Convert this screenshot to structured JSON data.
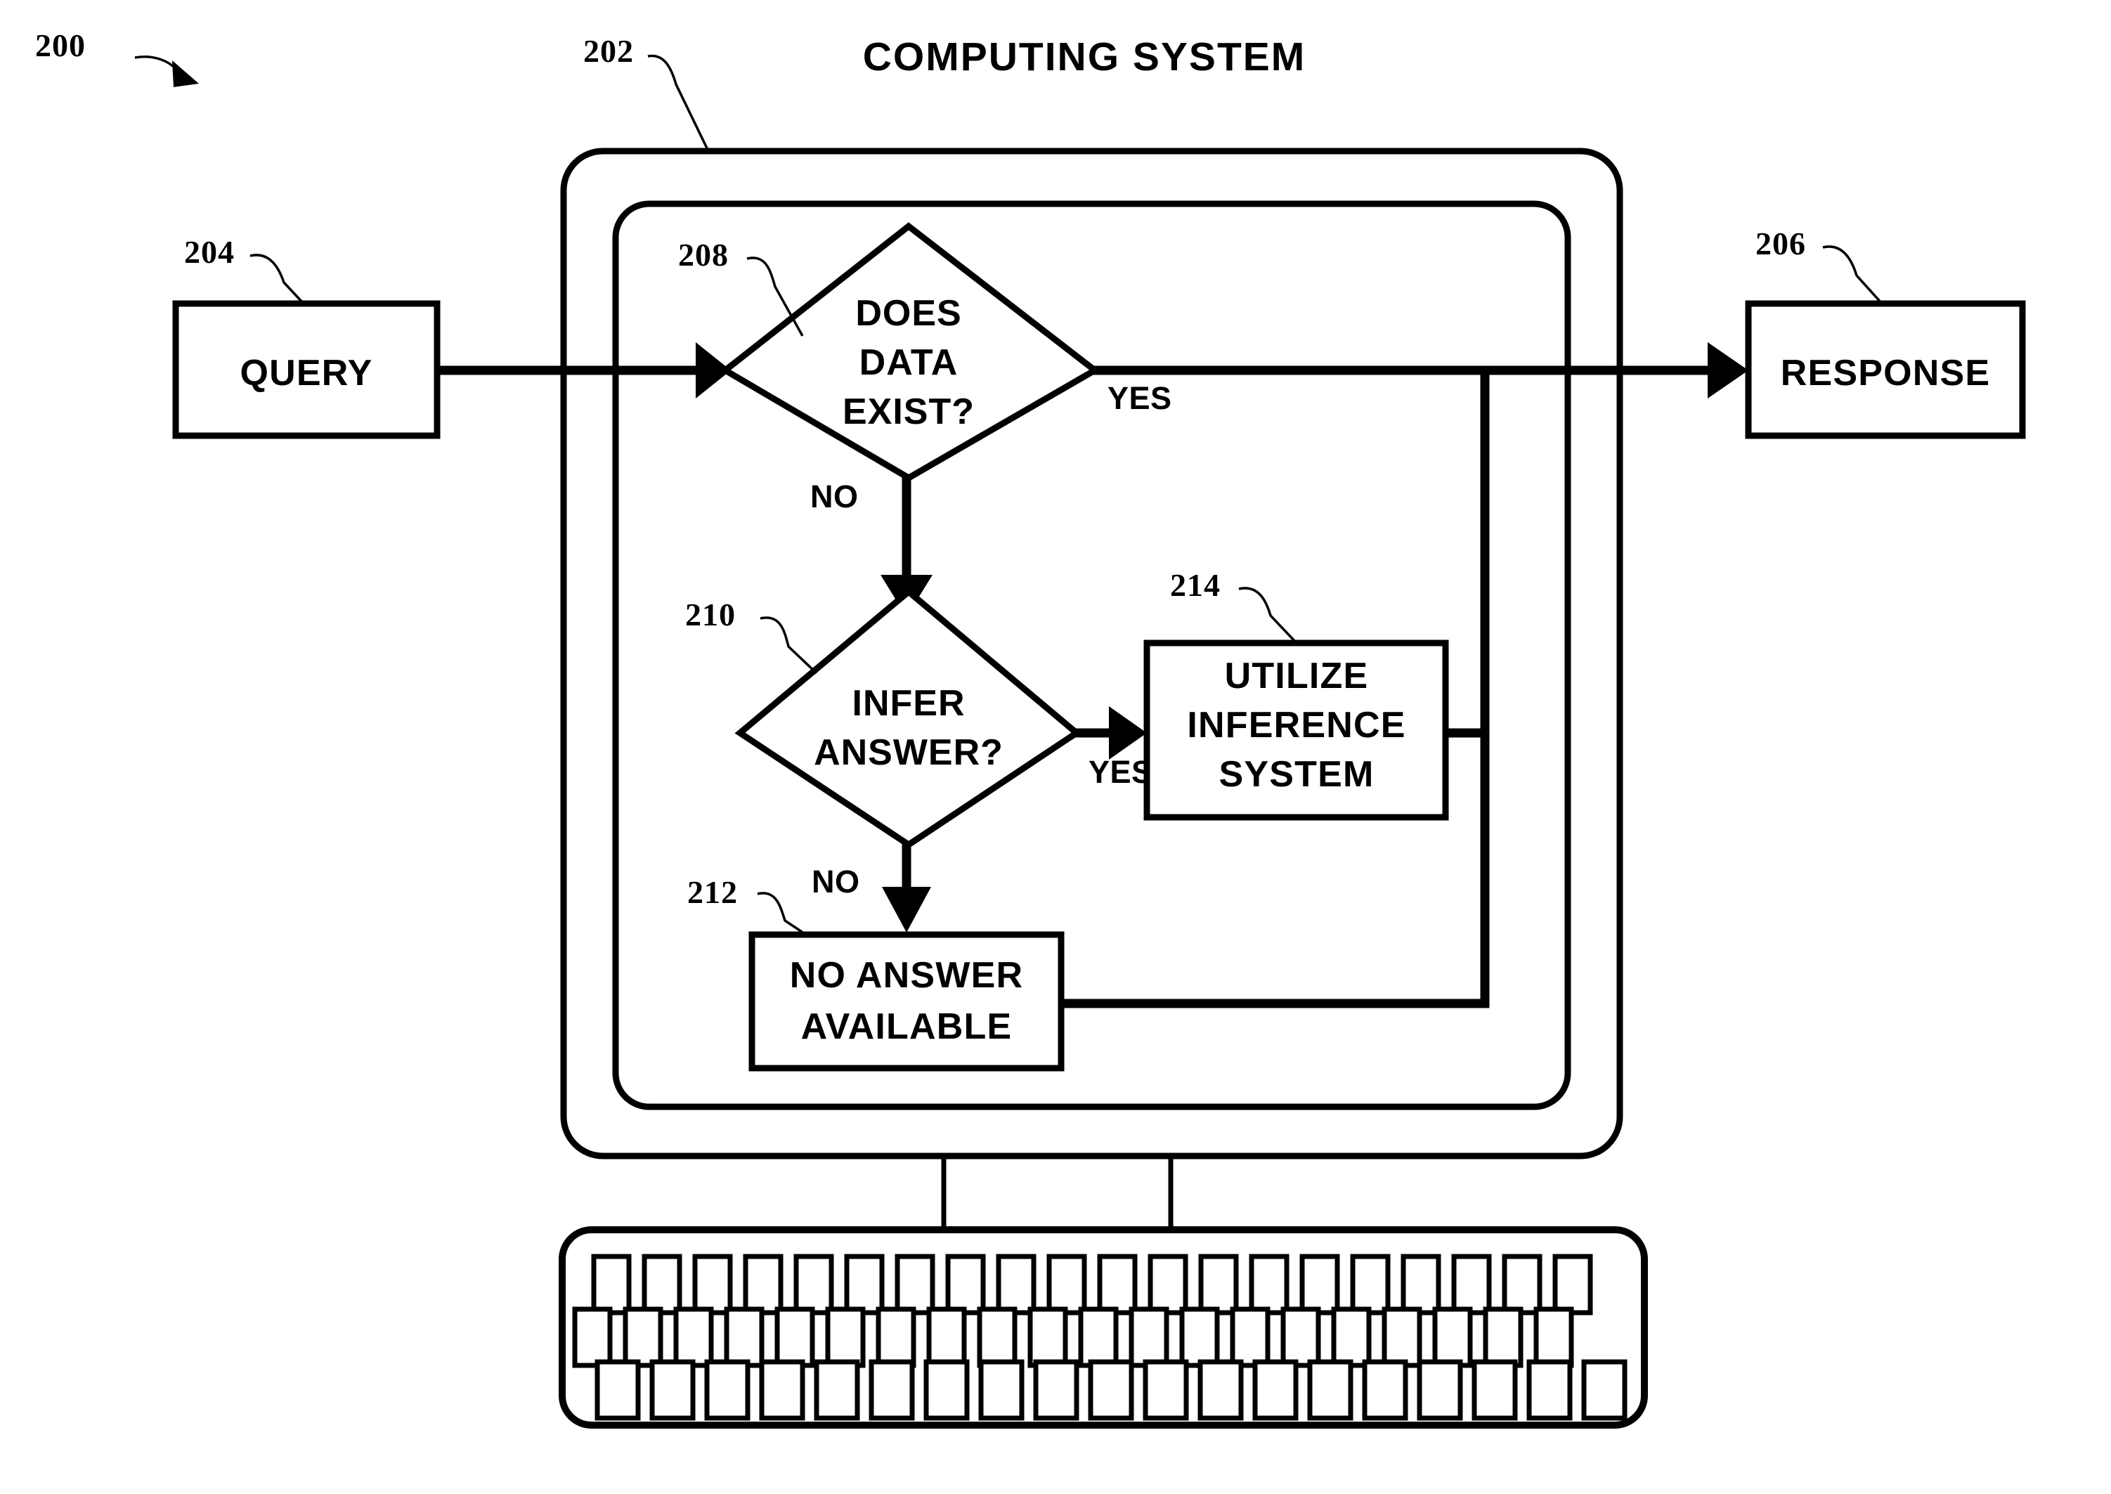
{
  "figure": {
    "figure_ref": "200",
    "title": "COMPUTING SYSTEM",
    "system_ref": "202"
  },
  "nodes": {
    "query": {
      "ref": "204",
      "label": "QUERY",
      "type": "process-box"
    },
    "response": {
      "ref": "206",
      "label": "RESPONSE",
      "type": "process-box"
    },
    "does_data_exist": {
      "ref": "208",
      "type": "decision-diamond",
      "lines": [
        "DOES",
        "DATA",
        "EXIST?"
      ]
    },
    "infer_answer": {
      "ref": "210",
      "type": "decision-diamond",
      "lines": [
        "INFER",
        "ANSWER?"
      ]
    },
    "no_answer_available": {
      "ref": "212",
      "type": "process-box",
      "lines": [
        "NO ANSWER",
        "AVAILABLE"
      ]
    },
    "utilize_inference_system": {
      "ref": "214",
      "type": "process-box",
      "lines": [
        "UTILIZE",
        "INFERENCE",
        "SYSTEM"
      ]
    }
  },
  "branch_labels": {
    "data_exist_yes": "YES",
    "data_exist_no": "NO",
    "infer_answer_yes": "YES",
    "infer_answer_no": "NO"
  },
  "hardware": {
    "monitor_name": "computer-monitor",
    "keyboard_name": "computer-keyboard",
    "keyboard_rows": 3,
    "keyboard_keys_per_row": 19
  },
  "colors": {
    "stroke": "#000000",
    "background": "#ffffff"
  }
}
